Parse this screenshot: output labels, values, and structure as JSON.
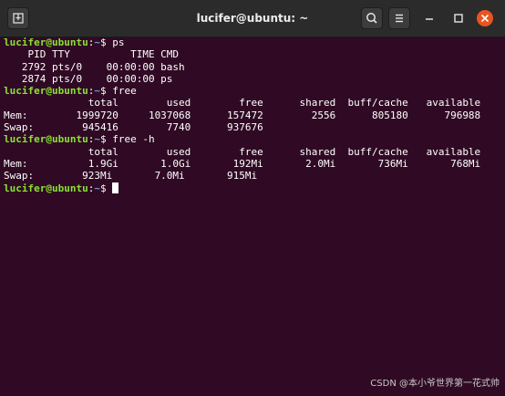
{
  "window": {
    "title": "lucifer@ubuntu: ~"
  },
  "colors": {
    "background": "#300a24",
    "titlebar": "#2b2b2b",
    "prompt_user": "#8ae234",
    "prompt_path": "#729fcf",
    "close_button": "#e95420"
  },
  "icons": {
    "new_tab": "new-tab-icon",
    "search": "search-icon",
    "menu": "hamburger-menu-icon",
    "minimize": "minimize-icon",
    "maximize": "maximize-icon",
    "close": "close-icon"
  },
  "terminal": {
    "prompt_user": "lucifer@ubuntu",
    "prompt_sep": ":",
    "prompt_path": "~",
    "prompt_end": "$ ",
    "lines": [
      {
        "type": "cmd",
        "text": "ps"
      },
      {
        "type": "out",
        "text": "    PID TTY          TIME CMD"
      },
      {
        "type": "out",
        "text": "   2792 pts/0    00:00:00 bash"
      },
      {
        "type": "out",
        "text": "   2874 pts/0    00:00:00 ps"
      },
      {
        "type": "cmd",
        "text": "free"
      },
      {
        "type": "out",
        "text": "              total        used        free      shared  buff/cache   available"
      },
      {
        "type": "out",
        "text": "Mem:        1999720     1037068      157472        2556      805180      796988"
      },
      {
        "type": "out",
        "text": "Swap:        945416        7740      937676"
      },
      {
        "type": "cmd",
        "text": "free -h"
      },
      {
        "type": "out",
        "text": "              total        used        free      shared  buff/cache   available"
      },
      {
        "type": "out",
        "text": "Mem:          1.9Gi       1.0Gi       192Mi       2.0Mi       736Mi       768Mi"
      },
      {
        "type": "out",
        "text": "Swap:        923Mi       7.0Mi       915Mi"
      },
      {
        "type": "cmd",
        "text": "",
        "cursor": true
      }
    ]
  },
  "watermark": "CSDN @本小爷世界第一花式帅"
}
